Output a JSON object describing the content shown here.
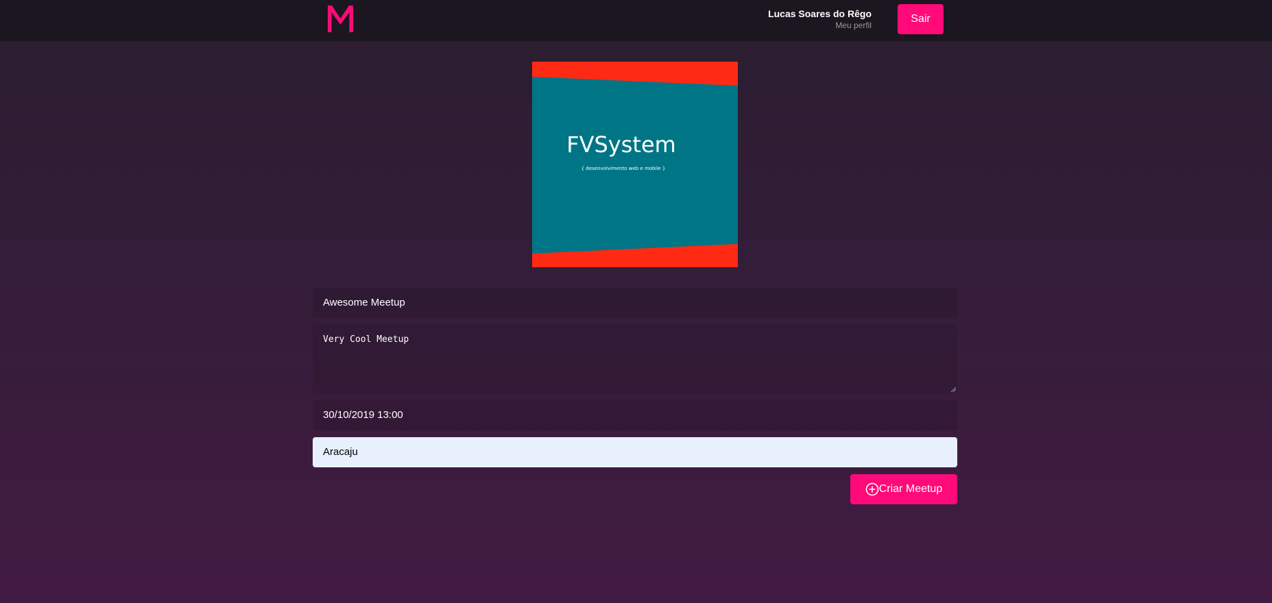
{
  "header": {
    "logo_letter": "M",
    "user_name": "Lucas Soares do Rêgo",
    "profile_link": "Meu perfil",
    "logout_label": "Sair"
  },
  "banner": {
    "title": "FVSystem",
    "subtitle": "{ desenvolvimento web e mobile }"
  },
  "form": {
    "title_value": "Awesome Meetup",
    "description_value": "Very Cool Meetup",
    "date_value": "30/10/2019 13:00",
    "location_value": "Aracaju",
    "submit_label": "Criar Meetup",
    "submit_icon": "add-circle-icon"
  },
  "colors": {
    "accent": "#ff0a78",
    "header_bg": "#1b161f",
    "banner_teal": "#007586",
    "banner_red": "#ff2a14"
  }
}
